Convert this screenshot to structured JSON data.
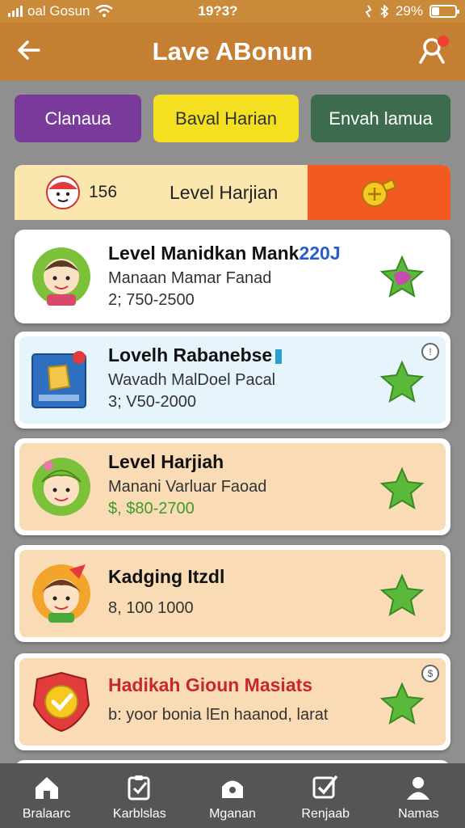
{
  "status": {
    "carrier": "oal Gosun",
    "time": "19?3?",
    "battery": "29%",
    "battery_level": 0.29
  },
  "header": {
    "title": "Lave ABonun"
  },
  "tabs": [
    {
      "label": "Clanaua"
    },
    {
      "label": "Baval Harian"
    },
    {
      "label": "Envah lamua"
    }
  ],
  "summary": {
    "count": "156",
    "label": "Level Harjian"
  },
  "cards": [
    {
      "title": "Level Manidkan Mank",
      "title_suffix": "220J",
      "subtitle": "Manaan Mamar Fanad",
      "range": "2; 750-2500"
    },
    {
      "title": "Lovelh Rabanebse",
      "title_suffix": "",
      "subtitle": "Wavadh MalDoel Pacal",
      "range": "3; V50-2000"
    },
    {
      "title": "Level Harjiah",
      "title_suffix": "",
      "subtitle": "Manani Varluar Faoad",
      "range": "$, $80-2700"
    },
    {
      "title": "Kadging Itzdl",
      "title_suffix": "",
      "subtitle": "",
      "range": "8, 100 1000"
    },
    {
      "title": "Hadikah Gioun Masiats",
      "title_suffix": "",
      "subtitle": "",
      "range": "b: yoor bonia lEn haanod, larat"
    }
  ],
  "nav": [
    {
      "label": "Bralaarc"
    },
    {
      "label": "Karblslas"
    },
    {
      "label": "Mganan"
    },
    {
      "label": "Renjaab"
    },
    {
      "label": "Namas"
    }
  ],
  "colors": {
    "header_bg": "#c47f32",
    "tab_purple": "#7a3a9c",
    "tab_yellow": "#f4e020",
    "tab_green": "#3d6b4d",
    "accent_orange": "#f25a22",
    "star_green": "#5ab83a"
  },
  "icons": [
    "back-arrow-icon",
    "badge-settings-icon",
    "home-icon",
    "checklist-icon",
    "house-icon",
    "checkbox-icon",
    "user-icon",
    "star-icon",
    "coin-icon",
    "info-icon"
  ]
}
